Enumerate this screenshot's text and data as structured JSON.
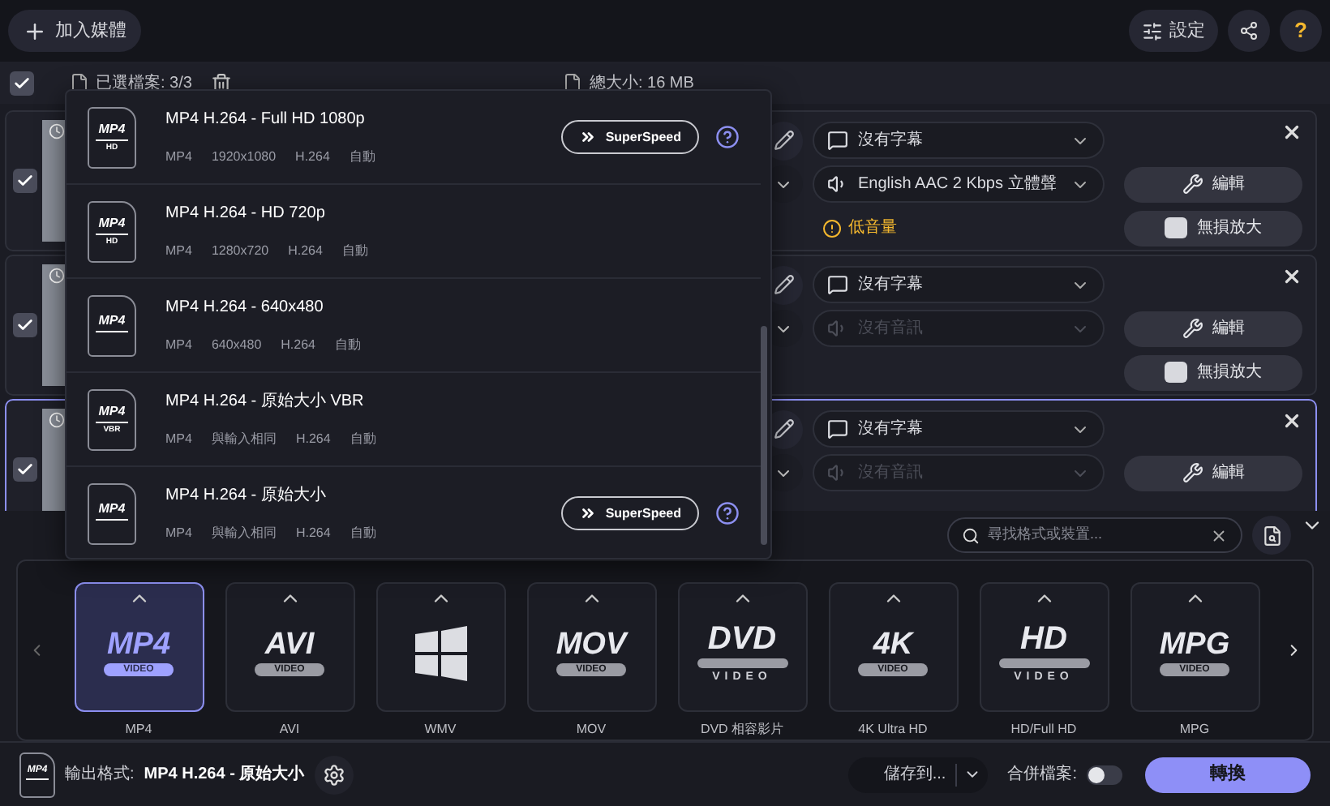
{
  "toolbar": {
    "add_media": "加入媒體",
    "settings": "設定",
    "help": "?"
  },
  "selection_bar": {
    "checked": true,
    "selected_files": "已選檔案: 3/3",
    "total_size": "總大小: 16 MB"
  },
  "files": [
    {
      "checked": true,
      "selected": false,
      "subtitle": "沒有字幕",
      "audio": "English AAC 2 Kbps 立體聲",
      "audio_disabled": false,
      "warning": "低音量",
      "edit": "編輯",
      "upscale": "無損放大"
    },
    {
      "checked": true,
      "selected": false,
      "subtitle": "沒有字幕",
      "audio": "沒有音訊",
      "audio_disabled": true,
      "edit": "編輯",
      "upscale": "無損放大"
    },
    {
      "checked": true,
      "selected": true,
      "subtitle": "沒有字幕",
      "audio": "沒有音訊",
      "audio_disabled": true,
      "edit": "編輯"
    }
  ],
  "preset_menu": {
    "items": [
      {
        "icon_label": "MP4",
        "icon_sub": "HD",
        "title": "MP4 H.264 - Full HD 1080p",
        "container": "MP4",
        "resolution": "1920x1080",
        "codec": "H.264",
        "bitrate": "自動",
        "superspeed": "SuperSpeed"
      },
      {
        "icon_label": "MP4",
        "icon_sub": "HD",
        "title": "MP4 H.264 - HD 720p",
        "container": "MP4",
        "resolution": "1280x720",
        "codec": "H.264",
        "bitrate": "自動"
      },
      {
        "icon_label": "MP4",
        "title": "MP4 H.264 - 640x480",
        "container": "MP4",
        "resolution": "640x480",
        "codec": "H.264",
        "bitrate": "自動"
      },
      {
        "icon_label": "MP4",
        "icon_sub": "VBR",
        "title": "MP4 H.264 - 原始大小 VBR",
        "container": "MP4",
        "resolution": "與輸入相同",
        "codec": "H.264",
        "bitrate": "自動"
      },
      {
        "icon_label": "MP4",
        "title": "MP4 H.264 - 原始大小",
        "container": "MP4",
        "resolution": "與輸入相同",
        "codec": "H.264",
        "bitrate": "自動",
        "superspeed": "SuperSpeed"
      }
    ]
  },
  "format_search": {
    "placeholder": "尋找格式或裝置..."
  },
  "formats": [
    {
      "kind": "pill",
      "logo": "MP4",
      "sub": "VIDEO",
      "label": "MP4",
      "selected": true
    },
    {
      "kind": "pill",
      "logo": "AVI",
      "sub": "VIDEO",
      "label": "AVI",
      "selected": false
    },
    {
      "kind": "windows",
      "label": "WMV",
      "selected": false
    },
    {
      "kind": "pill",
      "logo": "MOV",
      "sub": "VIDEO",
      "label": "MOV",
      "selected": false
    },
    {
      "kind": "disc",
      "logo": "DVD",
      "sub": "VIDEO",
      "label": "DVD 相容影片",
      "selected": false
    },
    {
      "kind": "pill",
      "logo": "4K",
      "sub": "VIDEO",
      "label": "4K Ultra HD",
      "selected": false
    },
    {
      "kind": "disc",
      "logo": "HD",
      "sub": "VIDEO",
      "label": "HD/Full HD",
      "selected": false
    },
    {
      "kind": "pill",
      "logo": "MPG",
      "sub": "VIDEO",
      "label": "MPG",
      "selected": false
    }
  ],
  "output": {
    "icon_label": "MP4",
    "label": "輸出格式:",
    "value": "MP4 H.264 - 原始大小"
  },
  "save_to": "儲存到...",
  "merge": {
    "label": "合併檔案:",
    "on": false
  },
  "convert": "轉換"
}
